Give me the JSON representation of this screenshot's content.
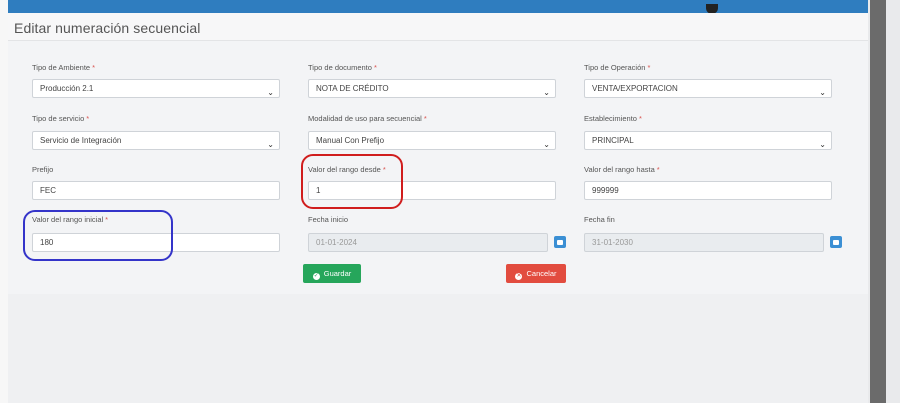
{
  "title": "Editar numeración secuencial",
  "fields": {
    "tipo_ambiente": {
      "label": "Tipo de Ambiente",
      "value": "Producción 2.1"
    },
    "tipo_documento": {
      "label": "Tipo de documento",
      "value": "NOTA DE CRÉDITO"
    },
    "tipo_operacion": {
      "label": "Tipo de Operación",
      "value": "VENTA/EXPORTACION"
    },
    "tipo_servicio": {
      "label": "Tipo de servicio",
      "value": "Servicio de Integración"
    },
    "modalidad": {
      "label": "Modalidad de uso para secuencial",
      "value": "Manual Con Prefijo"
    },
    "establecimiento": {
      "label": "Establecimiento",
      "value": "PRINCIPAL"
    },
    "prefijo": {
      "label": "Prefijo",
      "value": "FEC"
    },
    "rango_desde": {
      "label": "Valor del rango desde",
      "value": "1"
    },
    "rango_hasta": {
      "label": "Valor del rango hasta",
      "value": "999999"
    },
    "rango_inicial": {
      "label": "Valor del rango inicial",
      "value": "180"
    },
    "fecha_inicio": {
      "label": "Fecha inicio",
      "value": "01-01-2024"
    },
    "fecha_fin": {
      "label": "Fecha fin",
      "value": "31-01-2030"
    }
  },
  "buttons": {
    "save": "Guardar",
    "cancel": "Cancelar"
  },
  "colors": {
    "topbar": "#2f7dbf",
    "save": "#26a65b",
    "cancel": "#e24c3f",
    "required": "#d9534f",
    "annotation_blue": "#3434c9",
    "annotation_red": "#d01d1d"
  }
}
